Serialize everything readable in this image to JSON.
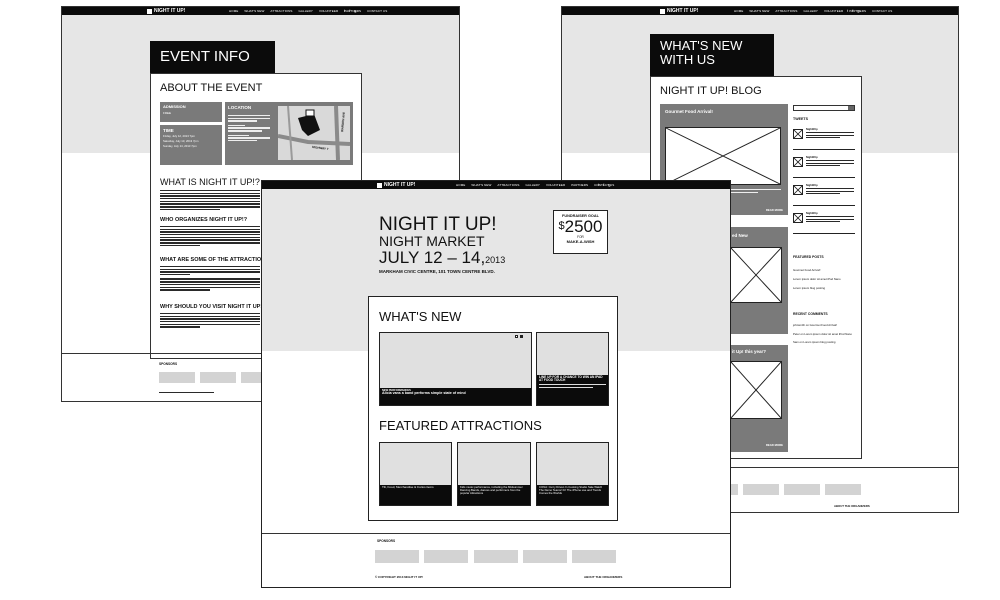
{
  "nav": {
    "logo": "NIGHT IT UP!",
    "links": [
      "HOME",
      "WHAT'S NEW",
      "ATTRACTIONS",
      "GALLERY",
      "VOLUNTEER",
      "PARTNERS",
      "CONTACT US"
    ],
    "social": [
      "t",
      "f",
      "g"
    ]
  },
  "event": {
    "tag": "EVENT INFO",
    "about_heading": "ABOUT THE EVENT",
    "admission_label": "ADMISSION",
    "admission_value": "FREE",
    "time_label": "TIME",
    "time_lines": [
      "Friday, July 12, 2013 7pm",
      "Saturday, July 13, 2013 7pm",
      "Sunday, July 14, 2013 7pm"
    ],
    "location_label": "LOCATION",
    "map_road": "HIGHWAY 7",
    "map_road_2": "WARDEN AVE",
    "what_is_heading": "WHAT IS NIGHT IT UP!?",
    "who_heading": "WHO ORGANIZES NIGHT IT UP!?",
    "attractions_heading": "WHAT ARE SOME OF THE ATTRACTIONS?",
    "why_heading": "WHY SHOULD YOU VISIT NIGHT IT UP!?",
    "sponsors_label": "SPONSORS"
  },
  "blog": {
    "tag": "WHAT'S NEW WITH US",
    "heading": "NIGHT IT UP! BLOG",
    "post1_title": "Gourmet Food Arrival!",
    "post2_title": "ed New",
    "post3_title": "it Up! this year?",
    "read_more": "READ MORE",
    "tweets_heading": "TWEETS",
    "tweet_author": "NightItUp",
    "featured_posts_heading": "FEATURED POSTS",
    "featured_posts": [
      "Gourmet Food Arrival!",
      "Lorem ipsum dolor sit amet iPod Nano",
      "Lorem ipsum blog posting"
    ],
    "recent_comments_heading": "RECENT COMMENTS",
    "recent_comments": [
      "johnsmith on Gourmet Food Arrival!",
      "Peter on Lorem ipsum dolor sit amet iPod Nano",
      "Sam on Lorem ipsum blog posting"
    ],
    "about_organizers": "ABOUT THE ORGANIZERS"
  },
  "home": {
    "title_line1": "NIGHT IT UP!",
    "title_line2": "NIGHT MARKET",
    "title_line3": "JULY 12 – 14,",
    "title_year": "2013",
    "venue": "MARKHAM CIVIC CENTRE, 101 TOWN CENTRE BLVD.",
    "fund_label": "FUNDRAISER GOAL",
    "fund_currency": "$",
    "fund_amount": "2500",
    "fund_for": "FOR",
    "fund_charity": "MAKE-A-WISH",
    "whats_new_heading": "WHAT'S NEW",
    "whats_new_caption_title": "NEW PERFORMANCES",
    "whats_new_caption_body": "Alicia vans a band performs simple state of mind",
    "side_caption": "LINE UP FOR A CHANCE TO WIN AN IPAD AT FOOD TOUCH",
    "featured_heading": "FEATURED ATTRACTIONS",
    "feature_captions": [
      "Tilt, Food, Merchandise & Curios items",
      "Kids music performance, including the Midsummer Dancing Bands, dances and performers from the popular Attractions",
      "CONA: Curry Driven In Cooking Studio Sale Watch The Demo Teams! FrI The iPhone use and Trends Comes the Worlds"
    ],
    "sponsors_label": "SPONSORS",
    "copyright": "© COPYRIGHT 2013 NIGHT IT UP!",
    "about_organizers": "ABOUT THE ORGANIZERS"
  }
}
